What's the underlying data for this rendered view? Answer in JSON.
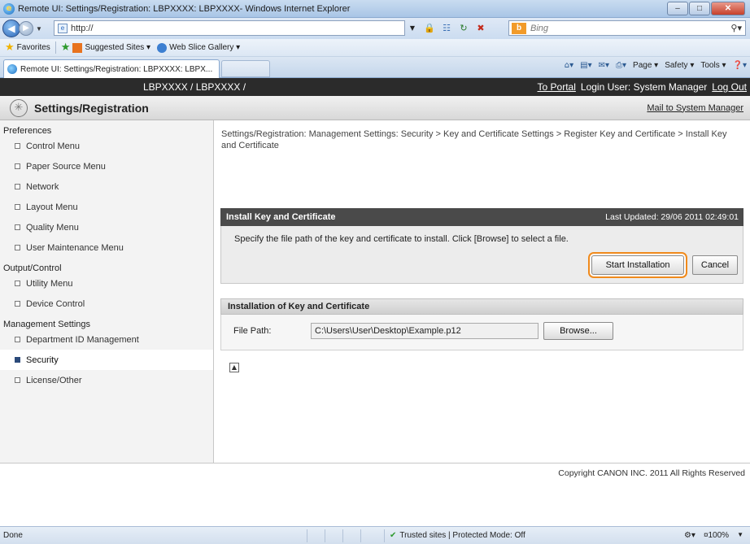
{
  "browser": {
    "window_title": "Remote UI: Settings/Registration: LBPXXXX: LBPXXXX- Windows Internet Explorer",
    "url": "http://",
    "search_placeholder": "Bing",
    "favorites_label": "Favorites",
    "favorites_items": [
      "Suggested Sites ▾",
      "Web Slice Gallery ▾"
    ],
    "tab_title": "Remote UI: Settings/Registration: LBPXXXX: LBPX...",
    "commands": [
      "Page ▾",
      "Safety ▾",
      "Tools ▾"
    ],
    "status_text": "Done",
    "zone_text": "Trusted sites | Protected Mode: Off",
    "zoom": "¤100%"
  },
  "header": {
    "device": "LBPXXXX / LBPXXXX /",
    "to_portal": "To Portal",
    "login_user": "Login User: System Manager",
    "logout": "Log Out"
  },
  "page": {
    "title": "Settings/Registration",
    "mail_link": "Mail to System Manager"
  },
  "sidebar": {
    "groups": [
      {
        "label": "Preferences",
        "items": [
          "Control Menu",
          "Paper Source Menu",
          "Network",
          "Layout Menu",
          "Quality Menu",
          "User Maintenance Menu"
        ]
      },
      {
        "label": "Output/Control",
        "items": [
          "Utility Menu",
          "Device Control"
        ]
      },
      {
        "label": "Management Settings",
        "items": [
          "Department ID Management",
          "Security",
          "License/Other"
        ]
      }
    ],
    "active": "Security"
  },
  "main": {
    "breadcrumb": "Settings/Registration: Management Settings: Security > Key and Certificate Settings > Register Key and Certificate > Install Key and Certificate",
    "panel_title": "Install Key and Certificate",
    "last_updated": "Last Updated: 29/06 2011 02:49:01",
    "instruction": "Specify the file path of the key and certificate to install. Click [Browse] to select a file.",
    "start_button": "Start Installation",
    "cancel_button": "Cancel",
    "section_title": "Installation of Key and Certificate",
    "file_path_label": "File Path:",
    "file_path_value": "C:\\Users\\User\\Desktop\\Example.p12",
    "browse_button": "Browse..."
  },
  "footer": {
    "copyright": "Copyright CANON INC. 2011 All Rights Reserved"
  },
  "colors": {
    "highlight": "#f08a1c",
    "header_bg": "#2b2b2b",
    "panel_header_bg": "#4a4a4a"
  }
}
